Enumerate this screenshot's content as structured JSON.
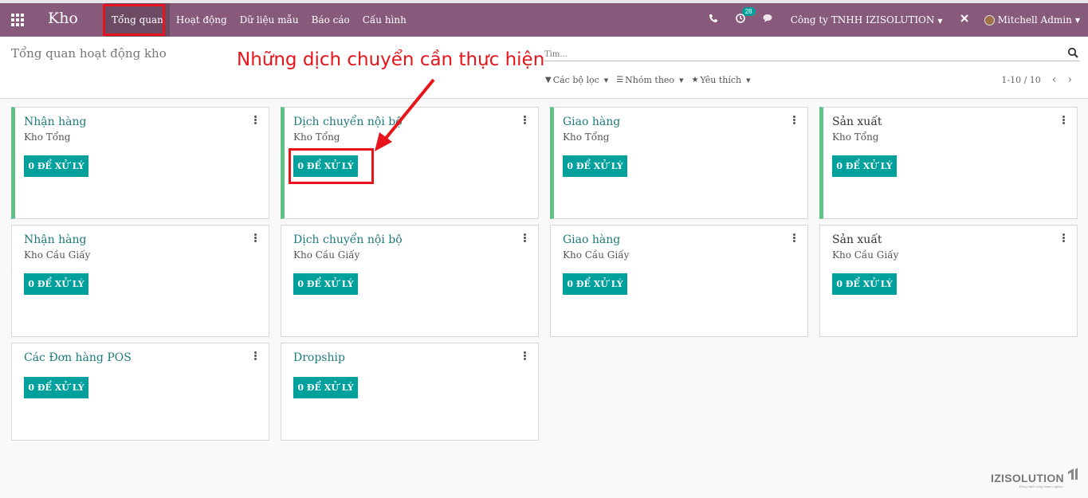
{
  "navbar": {
    "app_name": "Kho",
    "menu": [
      "Tổng quan",
      "Hoạt động",
      "Dữ liệu mẫu",
      "Báo cáo",
      "Cấu hình"
    ],
    "activity_count": "28",
    "company": "Công ty TNHH IZISOLUTION",
    "user": "Mitchell Admin"
  },
  "control_panel": {
    "title": "Tổng quan hoạt động kho",
    "search_placeholder": "Tìm...",
    "filters_label": "Các bộ lọc",
    "group_by_label": "Nhóm theo",
    "favorites_label": "Yêu thích",
    "pager": "1-10 / 10"
  },
  "annotation": "Những dịch chuyển cần thực hiện",
  "cards": [
    {
      "title": "Nhận hàng",
      "warehouse": "Kho Tổng",
      "button": "0 ĐỂ XỬ LÝ"
    },
    {
      "title": "Dịch chuyển nội bộ",
      "warehouse": "Kho Tổng",
      "button": "0 ĐỂ XỬ LÝ"
    },
    {
      "title": "Giao hàng",
      "warehouse": "Kho Tổng",
      "button": "0 ĐỂ XỬ LÝ"
    },
    {
      "title": "Sản xuất",
      "warehouse": "Kho Tổng",
      "button": "0 ĐỂ XỬ LÝ"
    },
    {
      "title": "Nhận hàng",
      "warehouse": "Kho Cầu Giấy",
      "button": "0 ĐỂ XỬ LÝ"
    },
    {
      "title": "Dịch chuyển nội bộ",
      "warehouse": "Kho Cầu Giấy",
      "button": "0 ĐỂ XỬ LÝ"
    },
    {
      "title": "Giao hàng",
      "warehouse": "Kho Cầu Giấy",
      "button": "0 ĐỂ XỬ LÝ"
    },
    {
      "title": "Sản xuất",
      "warehouse": "Kho Cầu Giấy",
      "button": "0 ĐỂ XỬ LÝ"
    },
    {
      "title": "Các Đơn hàng POS",
      "warehouse": "",
      "button": "0 ĐỂ XỬ LÝ"
    },
    {
      "title": "Dropship",
      "warehouse": "",
      "button": "0 ĐỂ XỬ LÝ"
    }
  ],
  "logo": {
    "name": "IZISOLUTION",
    "tagline": "Đồng hành cùng doanh nghiệp"
  },
  "colors": {
    "navbar": "#875a7b",
    "primary_button": "#00a09d",
    "accent_bar": "#5ec286",
    "annotation": "#e8141b"
  }
}
